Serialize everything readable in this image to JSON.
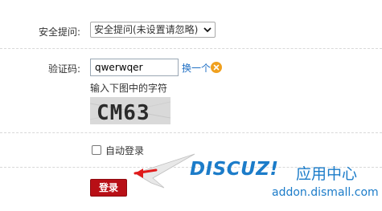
{
  "security": {
    "label": "安全提问:",
    "selected": "安全提问(未设置请忽略)"
  },
  "captcha": {
    "label": "验证码:",
    "value": "qwerwqer",
    "change_link": "换一个",
    "hint": "输入下图中的字符",
    "image_text": "CM63"
  },
  "auto_login": {
    "label": "自动登录",
    "checked": false
  },
  "login_button": "登录",
  "watermark": {
    "logo": "DISCUZ!",
    "cn": "应用中心",
    "url": "addon.dismall.com"
  },
  "colors": {
    "button": "#b80f16",
    "link": "#1f6fc4",
    "close_icon": "#f0a01e",
    "watermark": "#1c7cc9"
  },
  "icons": [
    "chevron-down-icon",
    "close-icon",
    "checkbox-icon",
    "arrow-icon"
  ]
}
